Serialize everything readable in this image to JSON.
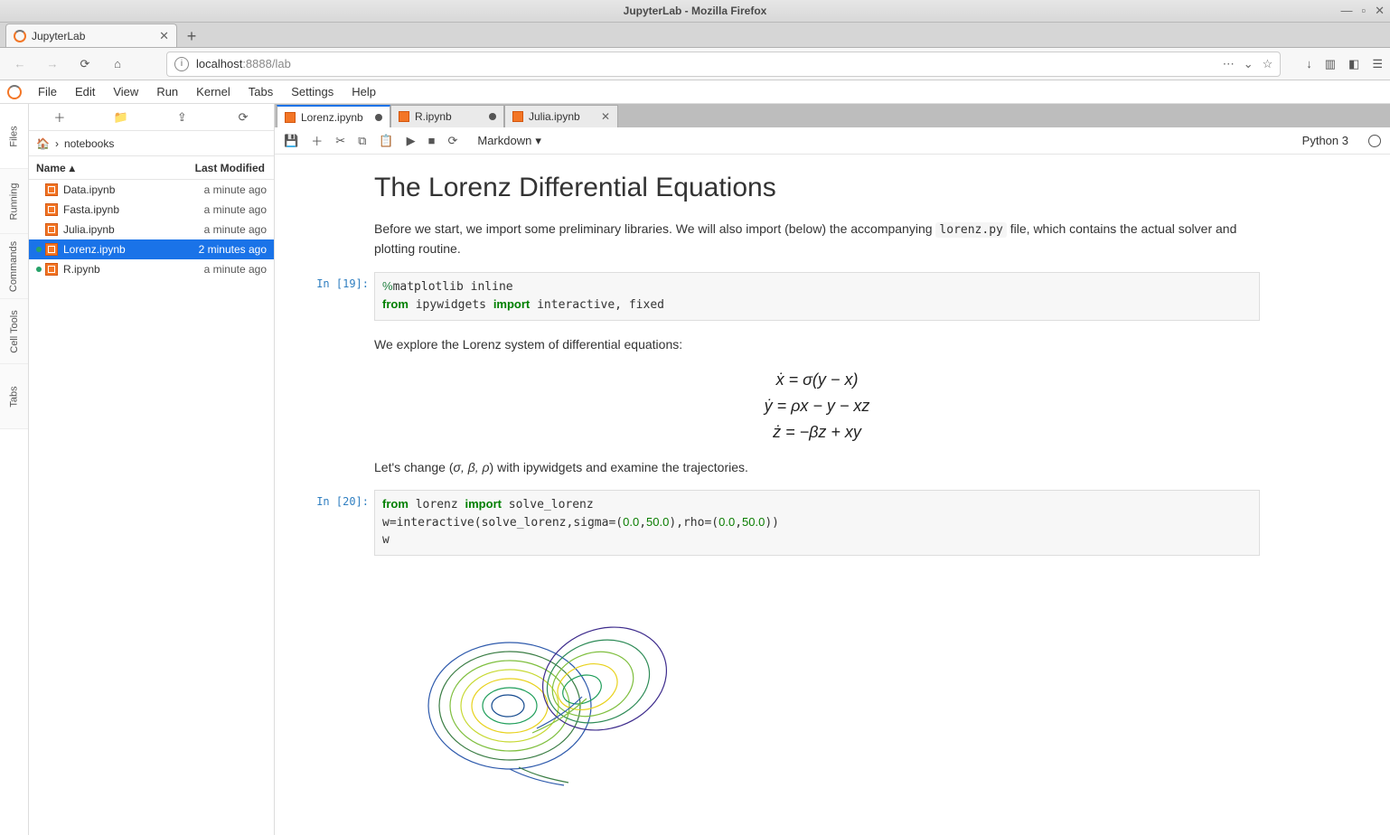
{
  "window": {
    "title": "JupyterLab - Mozilla Firefox"
  },
  "browser": {
    "tab_label": "JupyterLab",
    "url_host": "localhost",
    "url_path": ":8888/lab"
  },
  "menus": [
    "File",
    "Edit",
    "View",
    "Run",
    "Kernel",
    "Tabs",
    "Settings",
    "Help"
  ],
  "left_rail": [
    "Files",
    "Running",
    "Commands",
    "Cell Tools",
    "Tabs"
  ],
  "filebrowser": {
    "breadcrumb": "notebooks",
    "columns": {
      "name": "Name",
      "modified": "Last Modified"
    },
    "files": [
      {
        "name": "Data.ipynb",
        "modified": "a minute ago",
        "selected": false,
        "running": false
      },
      {
        "name": "Fasta.ipynb",
        "modified": "a minute ago",
        "selected": false,
        "running": false
      },
      {
        "name": "Julia.ipynb",
        "modified": "a minute ago",
        "selected": false,
        "running": false
      },
      {
        "name": "Lorenz.ipynb",
        "modified": "2 minutes ago",
        "selected": true,
        "running": true
      },
      {
        "name": "R.ipynb",
        "modified": "a minute ago",
        "selected": false,
        "running": true
      }
    ]
  },
  "doc_tabs": [
    {
      "label": "Lorenz.ipynb",
      "active": true,
      "dirty": true,
      "closable": false
    },
    {
      "label": "R.ipynb",
      "active": false,
      "dirty": true,
      "closable": false
    },
    {
      "label": "Julia.ipynb",
      "active": false,
      "dirty": false,
      "closable": true
    }
  ],
  "nb_toolbar": {
    "cell_type": "Markdown",
    "kernel": "Python 3"
  },
  "content": {
    "title": "The Lorenz Differential Equations",
    "intro_pre": "Before we start, we import some preliminary libraries. We will also import (below) the accompanying ",
    "intro_code": "lorenz.py",
    "intro_post": " file, which contains the actual solver and plotting routine.",
    "cell1_prompt": "In [19]:",
    "explore": "We explore the Lorenz system of differential equations:",
    "eq1": "ẋ = σ(y − x)",
    "eq2": "ẏ = ρx − y − xz",
    "eq3": "ż = −βz + xy",
    "change_pre": "Let's change (",
    "change_syms": "σ, β, ρ",
    "change_post": ") with ipywidgets and examine the trajectories.",
    "cell2_prompt": "In [20]:"
  }
}
